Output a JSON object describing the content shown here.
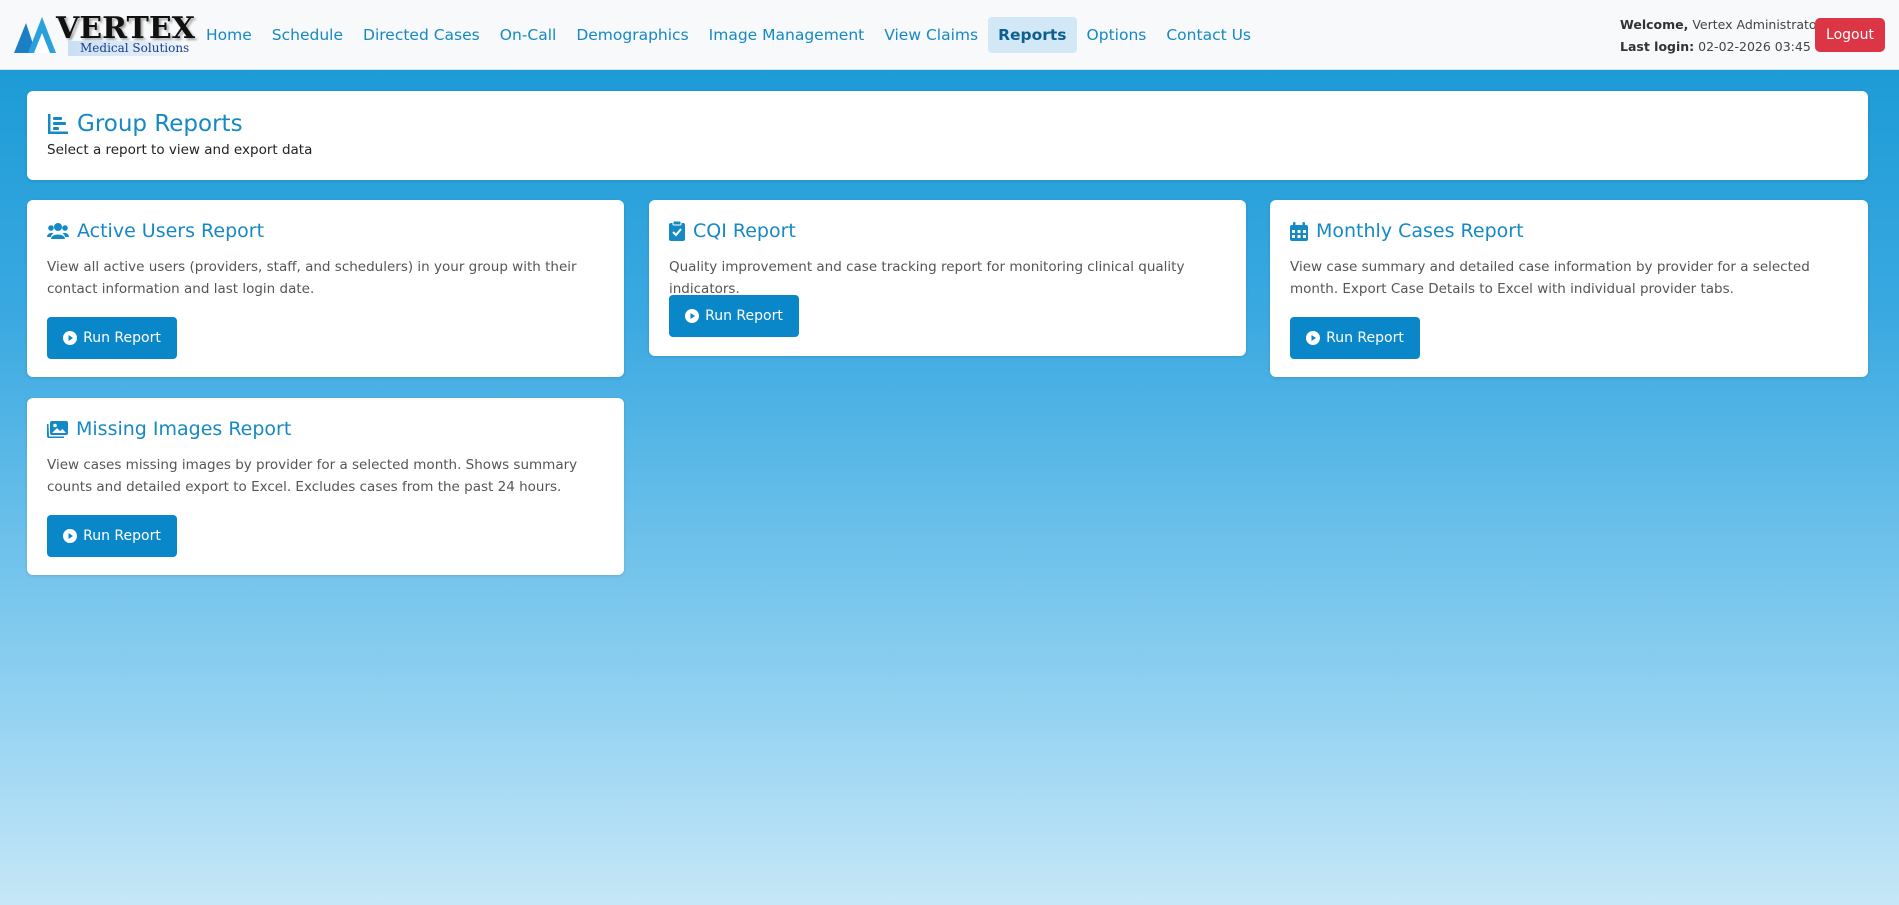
{
  "brand": {
    "name": "VERTEX",
    "tagline": "Medical Solutions"
  },
  "nav": {
    "items": [
      {
        "label": "Home"
      },
      {
        "label": "Schedule"
      },
      {
        "label": "Directed Cases"
      },
      {
        "label": "On-Call"
      },
      {
        "label": "Demographics"
      },
      {
        "label": "Image Management"
      },
      {
        "label": "View Claims"
      },
      {
        "label": "Reports",
        "active": true
      },
      {
        "label": "Options"
      },
      {
        "label": "Contact Us"
      }
    ]
  },
  "user": {
    "welcome_label": "Welcome,",
    "name": "Vertex Administrator",
    "last_login_label": "Last login:",
    "last_login": "02-02-2026 03:45",
    "logout_label": "Logout"
  },
  "page": {
    "title": "Group Reports",
    "subtitle": "Select a report to view and export data"
  },
  "reports": [
    {
      "title": "Active Users Report",
      "description": "View all active users (providers, staff, and schedulers) in your group with their contact information and last login date.",
      "button": "Run Report",
      "icon": "users-icon"
    },
    {
      "title": "CQI Report",
      "description": "Quality improvement and case tracking report for monitoring clinical quality indicators.",
      "button": "Run Report",
      "icon": "clipboard-check-icon"
    },
    {
      "title": "Monthly Cases Report",
      "description": "View case summary and detailed case information by provider for a selected month. Export Case Details to Excel with individual provider tabs.",
      "button": "Run Report",
      "icon": "calendar-icon"
    },
    {
      "title": "Missing Images Report",
      "description": "View cases missing images by provider for a selected month. Shows summary counts and detailed export to Excel. Excludes cases from the past 24 hours.",
      "button": "Run Report",
      "icon": "images-icon"
    }
  ],
  "colors": {
    "accent": "#1589c5",
    "button": "#0a87c8",
    "logout": "#dc3545"
  }
}
